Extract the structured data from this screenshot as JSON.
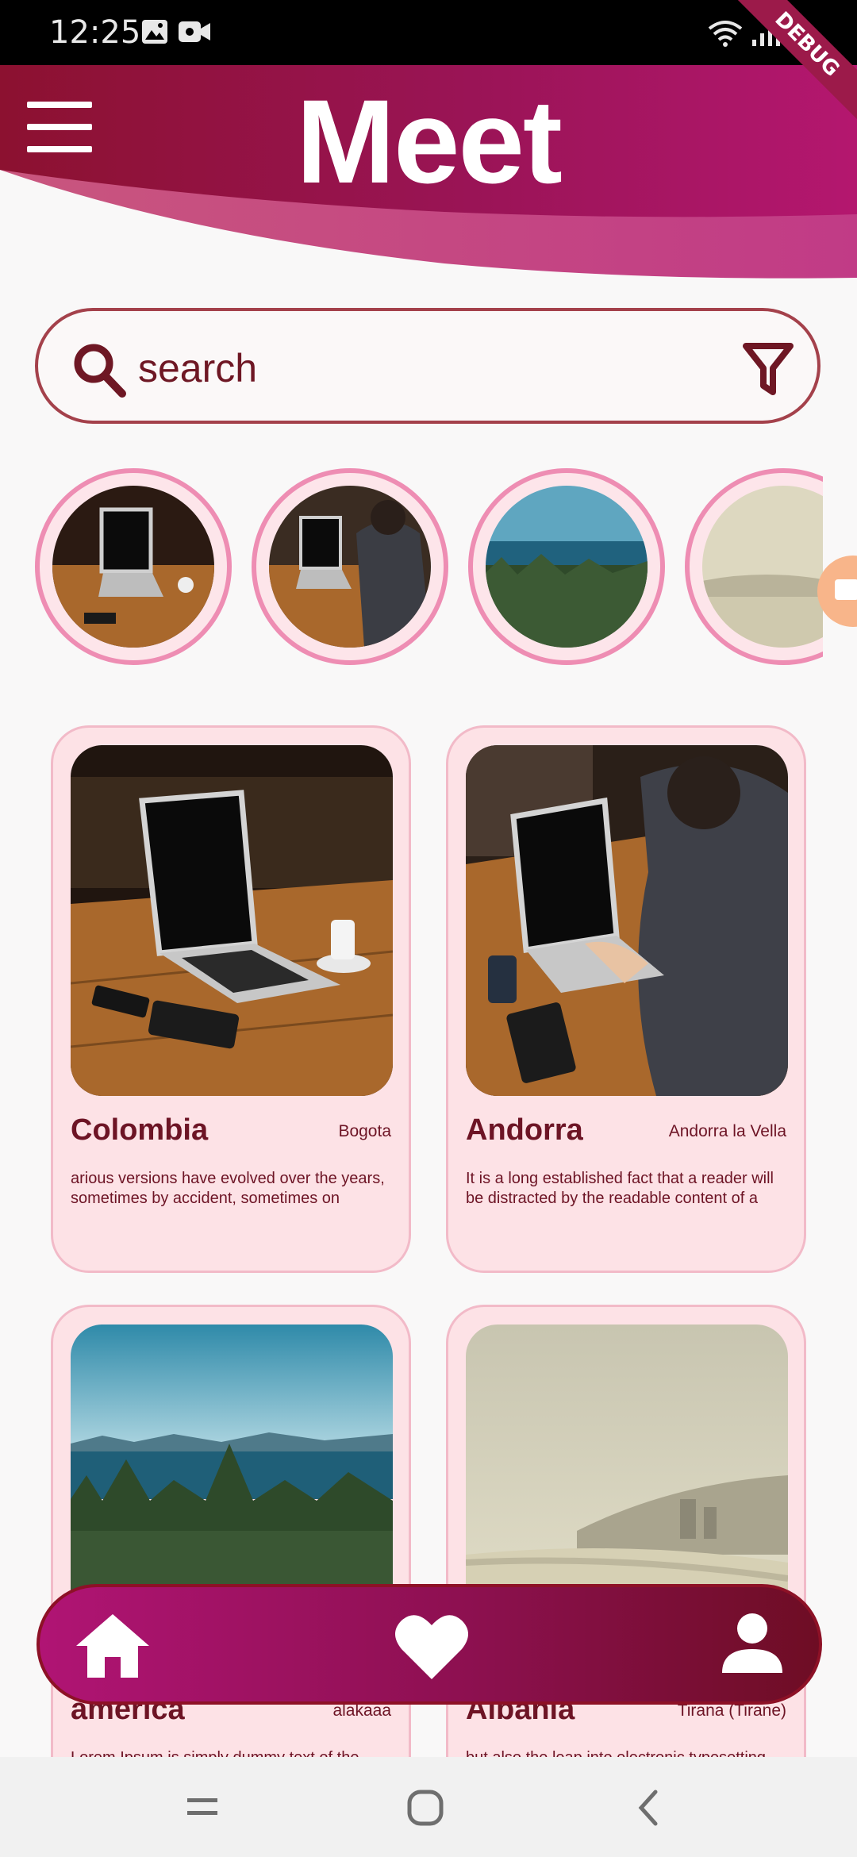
{
  "status_bar": {
    "time": "12:25",
    "debug_label": "DEBUG"
  },
  "header": {
    "title": "Meet",
    "menu_icon": "hamburger-menu-icon",
    "colors": {
      "primary": "#8c1130",
      "accent": "#b4176f"
    }
  },
  "search": {
    "placeholder": "search",
    "value": "",
    "icons": [
      "search-icon",
      "filter-icon"
    ]
  },
  "stories": [
    {
      "image": "laptop-on-table"
    },
    {
      "image": "man-typing-laptop"
    },
    {
      "image": "lake-forest"
    },
    {
      "image": "beach-haze"
    }
  ],
  "cards": [
    {
      "title": "Colombia",
      "capital": "Bogota",
      "description": "arious versions have evolved over the years, sometimes by accident, sometimes on",
      "image": "laptop-on-table"
    },
    {
      "title": "Andorra",
      "capital": "Andorra la Vella",
      "description": "It is a long established fact that a reader will be distracted by the readable content of a",
      "image": "man-typing-laptop"
    },
    {
      "title": "america",
      "capital": "alakaaa",
      "description": "Lorem Ipsum is simply dummy text of the",
      "image": "lake-forest"
    },
    {
      "title": "Albania",
      "capital": "Tirana (Tirane)",
      "description": "but also the leap into electronic typesetting",
      "image": "beach-haze"
    }
  ],
  "bottom_nav": {
    "items": [
      "home-icon",
      "heart-icon",
      "profile-icon"
    ]
  },
  "system_nav": {
    "items": [
      "recents-icon",
      "home-circle-icon",
      "back-icon"
    ]
  }
}
